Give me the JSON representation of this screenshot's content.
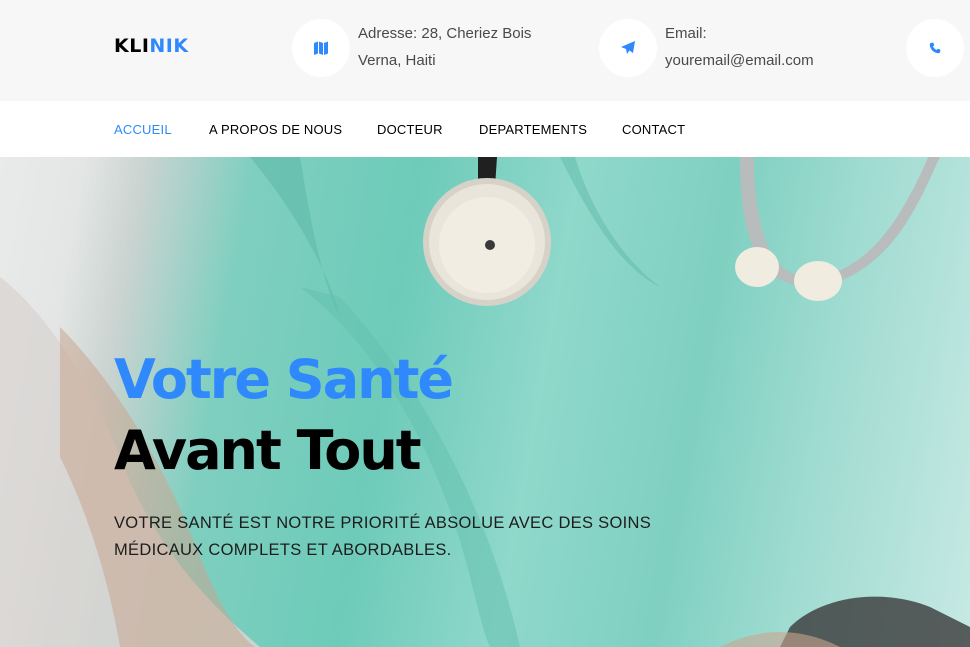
{
  "brand": {
    "logo_part1": "KLI",
    "logo_part2": "NIK",
    "accent_color": "#2f89fc"
  },
  "topbar": {
    "address": {
      "icon": "map-icon",
      "line1": "Adresse: 28, Cheriez Bois",
      "line2": "Verna, Haiti"
    },
    "email": {
      "icon": "paper-plane-icon",
      "line1": "Email:",
      "line2": "youremail@email.com"
    },
    "phone": {
      "icon": "phone-icon"
    }
  },
  "nav": {
    "items": [
      {
        "label": "ACCUEIL",
        "active": true
      },
      {
        "label": "A PROPOS DE NOUS",
        "active": false
      },
      {
        "label": "DOCTEUR",
        "active": false
      },
      {
        "label": "DEPARTEMENTS",
        "active": false
      },
      {
        "label": "CONTACT",
        "active": false
      }
    ]
  },
  "hero": {
    "title_line1": "Votre Santé",
    "title_line2": "Avant Tout",
    "subtitle": "VOTRE SANTÉ EST NOTRE PRIORITÉ ABSOLUE AVEC DES SOINS MÉDICAUX COMPLETS ET ABORDABLES.",
    "background_image": "doctor-with-stethoscope-photo"
  }
}
